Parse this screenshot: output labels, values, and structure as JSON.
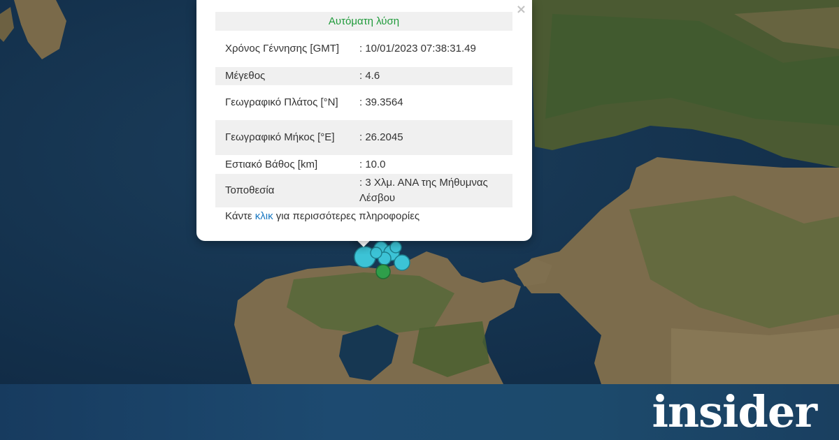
{
  "popup": {
    "header": "Αυτόματη λύση",
    "close_label": "×",
    "rows": [
      {
        "label": "Χρόνος Γέννησης [GMT]",
        "value": ": 10/01/2023 07:38:31.49"
      },
      {
        "label": "Μέγεθος",
        "value": ": 4.6"
      },
      {
        "label": "Γεωγραφικό Πλάτος [°N]",
        "value": ": 39.3564"
      },
      {
        "label": "Γεωγραφικό Μήκος [°E]",
        "value": ": 26.2045"
      },
      {
        "label": "Εστιακό Βάθος [km]",
        "value": ": 10.0"
      },
      {
        "label": "Τοποθεσία",
        "value": ": 3 Χλμ. ΑΝΑ της Μήθυμνας Λέσβου"
      }
    ],
    "more_prefix": "Κάντε ",
    "more_link": "κλικ",
    "more_suffix": " για περισσότερες πληροφορίες"
  },
  "markers": {
    "cyan_color": "#3cc3d6",
    "green_color": "#2f9e4a"
  },
  "banner": {
    "logo": "insider"
  }
}
